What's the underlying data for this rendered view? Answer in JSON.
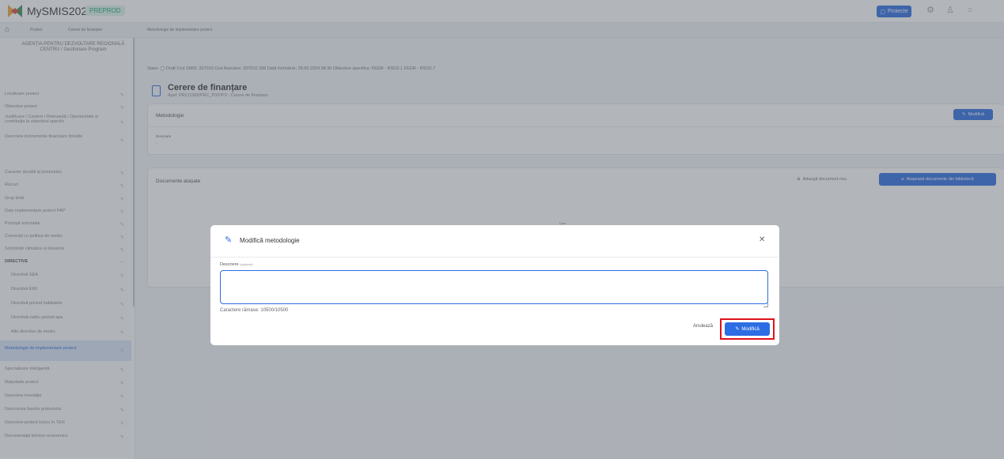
{
  "app": {
    "name": "MySMIS2021",
    "env": "PREPROD"
  },
  "topbar": {
    "projects_button": "Proiecte",
    "icons": [
      "gear-icon",
      "user-icon",
      "bell-icon"
    ]
  },
  "breadcrumb": [
    "Proiect",
    "Cerere de finanțare",
    "Metodologie de implementare proiect"
  ],
  "sidebar": {
    "agency": "AGENȚIA PENTRU DEZVOLTARE REGIONALĂ CENTRU / Gestionare Program",
    "items": [
      {
        "label": "Localizare proiect"
      },
      {
        "label": "Obiective proiect"
      },
      {
        "label": "Justificare / Context / Relevanță / Oportunitate și contribuția la obiectivul specific"
      },
      {
        "label": "Descriere instrumente financiare folosite"
      },
      {
        "label": "Caracter durabil al proiectului"
      },
      {
        "label": "Riscuri"
      },
      {
        "label": "Grup țintă"
      },
      {
        "label": "Date implementare proiect PAP"
      },
      {
        "label": "Principii orizontale"
      },
      {
        "label": "Coerență cu politica de mediu"
      },
      {
        "label": "Schimbări climatice și dezastre"
      },
      {
        "label": "DIRECTIVE"
      },
      {
        "label": "Directivă SEA"
      },
      {
        "label": "Directivă EIM"
      },
      {
        "label": "Directivă privind habitatele"
      },
      {
        "label": "Directivă-cadru privind apa"
      },
      {
        "label": "Alte directive de mediu"
      },
      {
        "label": "Metodologie de implementare proiect"
      },
      {
        "label": "Specializare inteligentă"
      },
      {
        "label": "Maturitate proiect"
      },
      {
        "label": "Descriere investiție"
      },
      {
        "label": "Descrierea fazelor proiectului"
      },
      {
        "label": "Descriere proiect inclus în TEN"
      },
      {
        "label": "Documentații tehnico-economice"
      }
    ]
  },
  "page": {
    "title": "Cerere de finanțare",
    "subtitle": "Apel: PRC/1366/PRC_P3/OP2 - Cerere de finanțare",
    "meta": "Stare: ◯ Draft   Cod SMIS: 327010   Cod Asociere: 337010 208   Dată închidere: 28.06.2024 08:30   Obiective specifice: FEDR - RSO2.1   FEDR - RSO2.7"
  },
  "methodology_card": {
    "title": "Metodologie",
    "edit_button": "Modifică",
    "field_label": "Descriere",
    "field_value": "-"
  },
  "documents_card": {
    "title": "Documente atașate",
    "add_button": "Adaugă document nou",
    "attach_button": "Atașează documente din bibliotecă",
    "empty_text": "Date"
  },
  "modal": {
    "title": "Modifică metodologie",
    "field_label": "Descriere",
    "field_optional": "(opțional)",
    "textarea_value": "",
    "chars_remaining": "Caractere rămase: 10500/10500",
    "cancel_button": "Anulează",
    "submit_button": "Modifică"
  },
  "colors": {
    "accent": "#2c6de3",
    "highlight": "#e0101b",
    "env_badge": "#1aa87a"
  }
}
